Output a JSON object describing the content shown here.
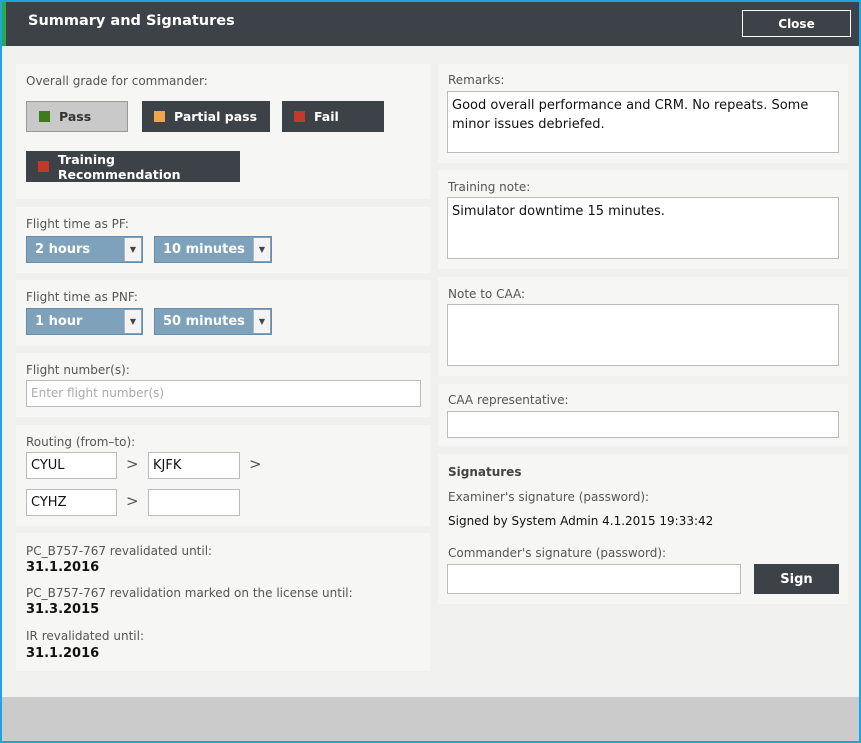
{
  "dialog": {
    "title": "Summary and Signatures",
    "close_label": "Close"
  },
  "grade": {
    "label": "Overall grade for commander:",
    "buttons": [
      {
        "label": "Pass",
        "color": "#3f7a1e",
        "selected": true
      },
      {
        "label": "Partial pass",
        "color": "#f0a54a",
        "selected": false
      },
      {
        "label": "Fail",
        "color": "#c0392b",
        "selected": false
      },
      {
        "label": "Training Recommendation",
        "color": "#c0392b",
        "selected": false
      }
    ]
  },
  "flight_time_pf": {
    "label": "Flight time as PF:",
    "hours": "2 hours",
    "minutes": "10 minutes"
  },
  "flight_time_pnf": {
    "label": "Flight time as PNF:",
    "hours": "1 hour",
    "minutes": "50 minutes"
  },
  "flight_number": {
    "label": "Flight number(s):",
    "placeholder": "Enter flight number(s)",
    "value": ""
  },
  "routing": {
    "label": "Routing (from–to):",
    "fields": [
      "CYUL",
      "KJFK",
      "CYHZ",
      ""
    ],
    "separator": ">"
  },
  "revalidation": [
    {
      "label": "PC_B757-767 revalidated until:",
      "value": "31.1.2016"
    },
    {
      "label": "PC_B757-767 revalidation marked on the license until:",
      "value": "31.3.2015"
    },
    {
      "label": "IR revalidated until:",
      "value": "31.1.2016"
    }
  ],
  "remarks": {
    "label": "Remarks:",
    "value": "Good overall performance and CRM. No repeats. Some minor issues debriefed."
  },
  "training_note": {
    "label": "Training note:",
    "value": "Simulator downtime 15 minutes."
  },
  "note_to_caa": {
    "label": "Note to CAA:",
    "value": ""
  },
  "caa_representative": {
    "label": "CAA representative:",
    "value": ""
  },
  "signatures": {
    "heading": "Signatures",
    "examiner_label": "Examiner's signature (password):",
    "examiner_status": "Signed by System Admin 4.1.2015 19:33:42",
    "commander_label": "Commander's signature (password):",
    "commander_value": "",
    "sign_label": "Sign"
  }
}
